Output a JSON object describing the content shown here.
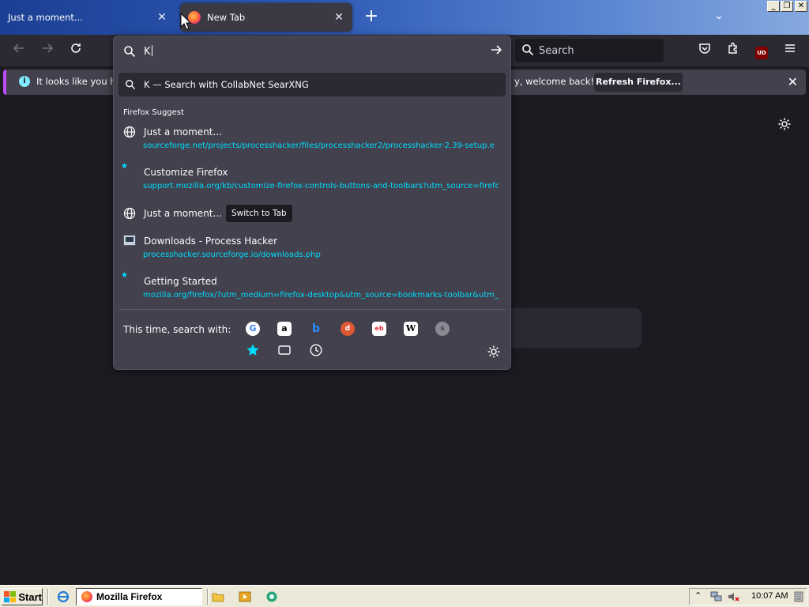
{
  "tabs": [
    {
      "title": "Just a moment...",
      "active": false
    },
    {
      "title": "New Tab",
      "active": true
    }
  ],
  "toolbar": {
    "search_placeholder": "Search"
  },
  "notification": {
    "text_left": "It looks like you have",
    "text_right": "y, welcome back!",
    "button": "Refresh Firefox..."
  },
  "urlbar": {
    "value": "K",
    "heuristic": "K — Search with CollabNet SearXNG",
    "section_label": "Firefox Suggest",
    "results": [
      {
        "title": "Just a moment...",
        "url": "sourceforge.net/projects/processhacker/files/processhacker2/processhacker-2.39-setup.e",
        "icon": "globe-icon"
      },
      {
        "title": "Customize Firefox",
        "url": "support.mozilla.org/kb/customize-firefox-controls-buttons-and-toolbars?utm_source=firefox-",
        "icon": "firefox-bookmark-icon"
      },
      {
        "title": "Just a moment...",
        "url": "",
        "icon": "globe-icon",
        "action": "Switch to Tab"
      },
      {
        "title": "Downloads - Process Hacker",
        "url": "processhacker.sourceforge.io/downloads.php",
        "icon": "process-hacker-icon"
      },
      {
        "title": "Getting Started",
        "url": "mozilla.org/firefox/?utm_medium=firefox-desktop&utm_source=bookmarks-toolbar&utm_ca",
        "icon": "firefox-bookmark-icon"
      }
    ],
    "oneoff_label": "This time, search with:",
    "engines": [
      "G",
      "a",
      "b",
      "d",
      "eb",
      "W",
      "s"
    ]
  },
  "taskbar": {
    "start": "Start",
    "task": "Mozilla Firefox",
    "clock": "10:07 AM"
  },
  "colors": {
    "accent": "#00ddff",
    "panel": "#42414d",
    "toolbar": "#2b2a33",
    "page": "#1c1b22"
  }
}
